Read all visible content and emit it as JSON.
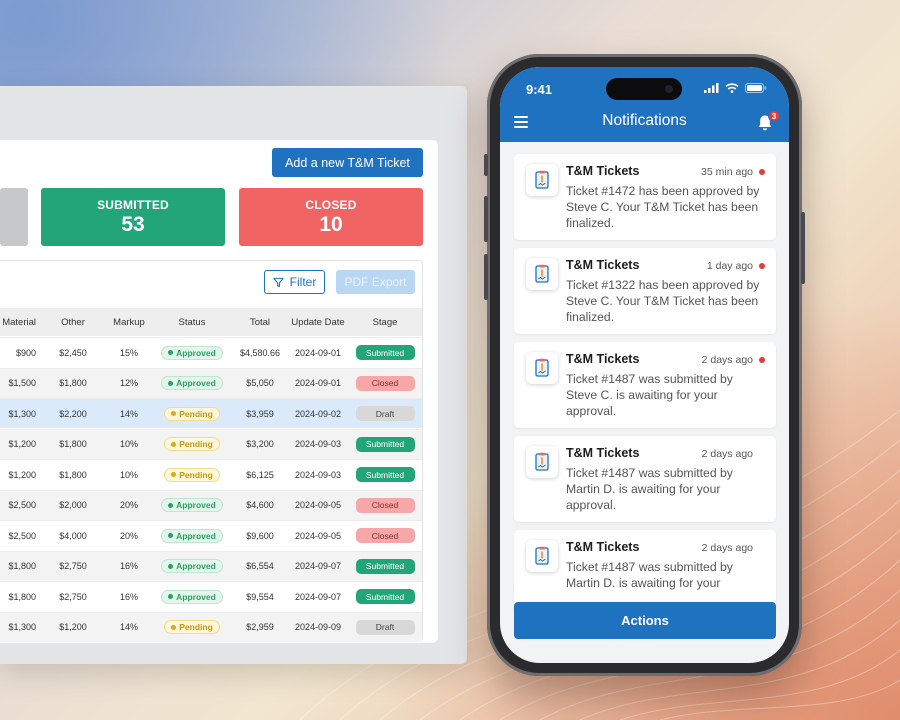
{
  "desktop": {
    "add_button": "Add a new T&M Ticket",
    "stats": [
      {
        "label": "SUBMITTED",
        "value": "53"
      },
      {
        "label": "CLOSED",
        "value": "10"
      }
    ],
    "filter_label": "Filter",
    "pdf_label": "PDF Export",
    "columns": [
      "Material",
      "Other",
      "Markup",
      "Status",
      "Total",
      "Update Date",
      "Stage"
    ],
    "rows": [
      {
        "material": "$900",
        "other": "$2,450",
        "markup": "15%",
        "status": "Approved",
        "total": "$4,580.66",
        "date": "2024-09-01",
        "stage": "Submitted"
      },
      {
        "material": "$1,500",
        "other": "$1,800",
        "markup": "12%",
        "status": "Approved",
        "total": "$5,050",
        "date": "2024-09-01",
        "stage": "Closed"
      },
      {
        "material": "$1,300",
        "other": "$2,200",
        "markup": "14%",
        "status": "Pending",
        "total": "$3,959",
        "date": "2024-09-02",
        "stage": "Draft"
      },
      {
        "material": "$1,200",
        "other": "$1,800",
        "markup": "10%",
        "status": "Pending",
        "total": "$3,200",
        "date": "2024-09-03",
        "stage": "Submitted"
      },
      {
        "material": "$1,200",
        "other": "$1,800",
        "markup": "10%",
        "status": "Pending",
        "total": "$6,125",
        "date": "2024-09-03",
        "stage": "Submitted"
      },
      {
        "material": "$2,500",
        "other": "$2,000",
        "markup": "20%",
        "status": "Approved",
        "total": "$4,600",
        "date": "2024-09-05",
        "stage": "Closed"
      },
      {
        "material": "$2,500",
        "other": "$4,000",
        "markup": "20%",
        "status": "Approved",
        "total": "$9,600",
        "date": "2024-09-05",
        "stage": "Closed"
      },
      {
        "material": "$1,800",
        "other": "$2,750",
        "markup": "16%",
        "status": "Approved",
        "total": "$6,554",
        "date": "2024-09-07",
        "stage": "Submitted"
      },
      {
        "material": "$1,800",
        "other": "$2,750",
        "markup": "16%",
        "status": "Approved",
        "total": "$9,554",
        "date": "2024-09-07",
        "stage": "Submitted"
      },
      {
        "material": "$1,300",
        "other": "$1,200",
        "markup": "14%",
        "status": "Pending",
        "total": "$2,959",
        "date": "2024-09-09",
        "stage": "Draft"
      }
    ]
  },
  "phone": {
    "time": "9:41",
    "title": "Notifications",
    "badge_count": "3",
    "notifications": [
      {
        "title": "T&M Tickets",
        "time": "35 min ago",
        "unread": true,
        "body": "Ticket #1472 has been approved by Steve C. Your T&M Ticket has been finalized."
      },
      {
        "title": "T&M Tickets",
        "time": "1 day ago",
        "unread": true,
        "body": "Ticket #1322 has been approved by Steve C.  Your T&M Ticket has been finalized."
      },
      {
        "title": "T&M Tickets",
        "time": "2 days ago",
        "unread": true,
        "body": "Ticket #1487 was submitted by Steve C.  is awaiting for your approval."
      },
      {
        "title": "T&M Tickets",
        "time": "2 days ago",
        "unread": false,
        "body": "Ticket #1487 was submitted by Martin D.  is awaiting for your approval."
      },
      {
        "title": "T&M Tickets",
        "time": "2 days ago",
        "unread": false,
        "body": "Ticket #1487 was submitted by Martin D.  is awaiting for your"
      }
    ],
    "actions_label": "Actions"
  },
  "colors": {
    "brand": "#1f72c0",
    "submitted": "#22a578",
    "closed": "#f06464",
    "approved": "#2c9e63",
    "pending": "#e0a90f",
    "unread_dot": "#e63b3b"
  },
  "icons": [
    "filter-icon",
    "menu-icon",
    "bell-icon",
    "signal-icon",
    "wifi-icon",
    "battery-icon",
    "ticket-document-icon"
  ]
}
